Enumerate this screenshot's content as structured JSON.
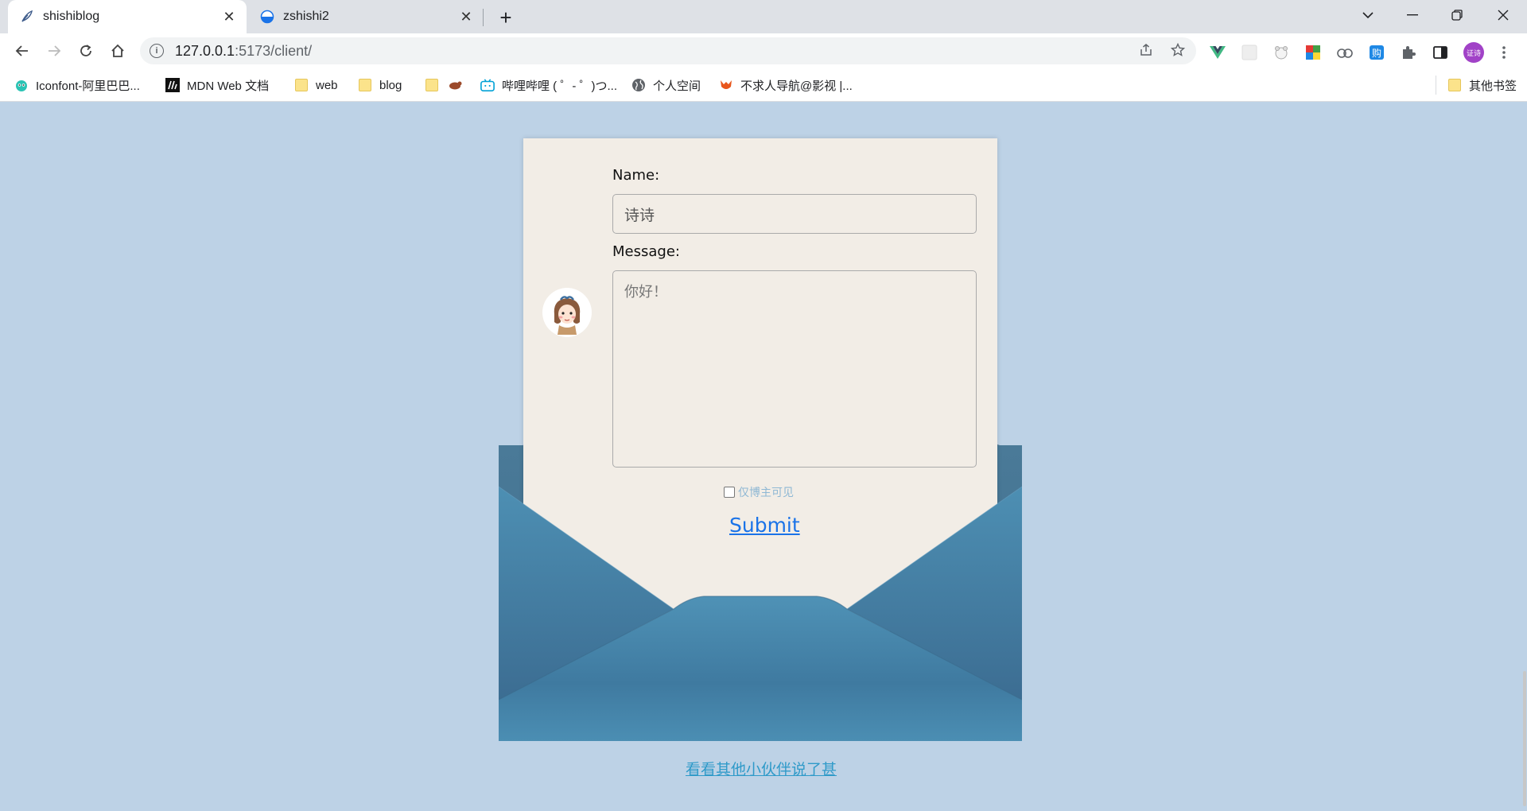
{
  "browser": {
    "tabs": [
      {
        "title": "shishiblog",
        "active": true,
        "icon": "feather-icon"
      },
      {
        "title": "zshishi2",
        "active": false,
        "icon": "half-circle-icon"
      }
    ],
    "close_glyph": "✕",
    "new_tab_glyph": "+",
    "window_controls": {
      "tab_search": "⌄",
      "minimize": "—",
      "restore": "❐",
      "close": "✕"
    },
    "url": {
      "host": "127.0.0.1",
      "rest": ":5173/client/"
    },
    "avatar_text": "证诗",
    "bookmarks": [
      {
        "label": "Iconfont-阿里巴巴...",
        "icon": "iconfont-icon"
      },
      {
        "label": "MDN Web 文档",
        "icon": "mdn-icon"
      },
      {
        "label": "web",
        "icon": "folder-icon"
      },
      {
        "label": "blog",
        "icon": "folder-icon"
      },
      {
        "label": "",
        "icon": "folder-icon"
      },
      {
        "label": "",
        "icon": "cow-icon"
      },
      {
        "label": "哔哩哔哩 ( ゜- ゜)つ...",
        "icon": "bilibili-icon"
      },
      {
        "label": "个人空间",
        "icon": "globe-icon"
      },
      {
        "label": "不求人导航@影视 |...",
        "icon": "fox-icon"
      }
    ],
    "other_bookmarks": "其他书签"
  },
  "form": {
    "name_label": "Name:",
    "name_value": "诗诗",
    "message_label": "Message:",
    "message_placeholder": "你好！",
    "private_label": "仅博主可见",
    "private_checked": false,
    "submit_label": "Submit"
  },
  "footer_link": "看看其他小伙伴说了甚",
  "colors": {
    "page_bg": "#bdd2e6",
    "envelope": "#4a89ad",
    "letter": "#f2ede6",
    "submit_link": "#1a73e8",
    "footer_link": "#2f9ac9"
  }
}
